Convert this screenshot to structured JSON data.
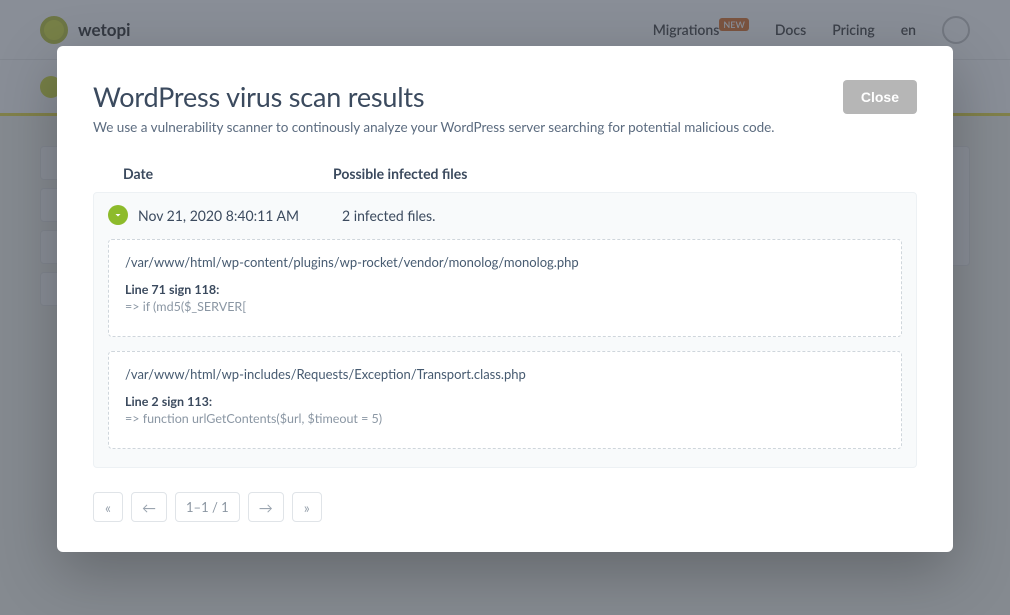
{
  "bg": {
    "brand": "wetopi",
    "nav": {
      "migrations": "Migrations",
      "migrations_badge": "NEW",
      "docs": "Docs",
      "pricing": "Pricing",
      "lang": "en"
    }
  },
  "modal": {
    "title": "WordPress virus scan results",
    "subtitle": "We use a vulnerability scanner to continously analyze your WordPress server searching for potential malicious code.",
    "close_label": "Close",
    "headers": {
      "date": "Date",
      "files": "Possible infected files"
    },
    "row": {
      "date": "Nov 21, 2020 8:40:11 AM",
      "summary": "2 infected files.",
      "files": [
        {
          "path": "/var/www/html/wp-content/plugins/wp-rocket/vendor/monolog/monolog.php",
          "line": "Line 71 sign 118:",
          "snippet": "=> if (md5($_SERVER["
        },
        {
          "path": "/var/www/html/wp-includes/Requests/Exception/Transport.class.php",
          "line": "Line 2 sign 113:",
          "snippet": "=> function urlGetContents($url, $timeout = 5)"
        }
      ]
    },
    "pager": {
      "first": "«",
      "prev": "←",
      "range": "1–1 / 1",
      "next": "→",
      "last": "»"
    }
  }
}
